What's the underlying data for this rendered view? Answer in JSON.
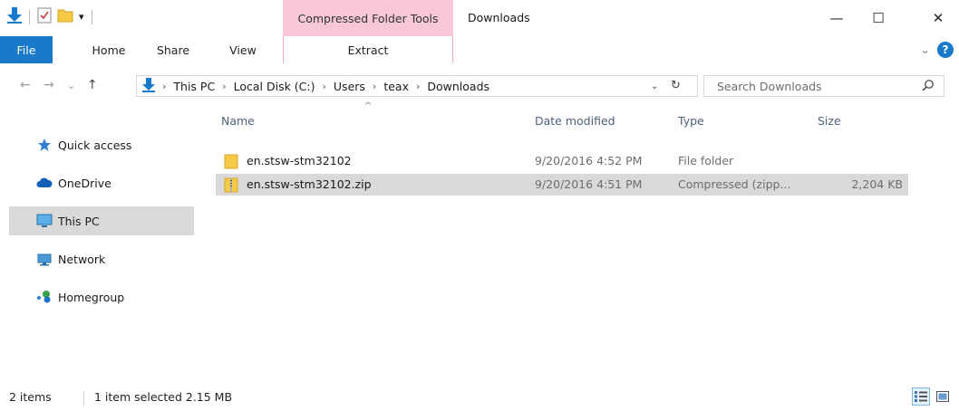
{
  "window": {
    "title": "Downloads",
    "context_tools": "Compressed Folder Tools",
    "minimize": "—",
    "maximize": "☐",
    "close": "✕"
  },
  "qat": {
    "dropdown": "▾"
  },
  "ribbon": {
    "tabs": [
      "File",
      "Home",
      "Share",
      "View",
      "Extract"
    ],
    "collapse": "⌄",
    "help": "?"
  },
  "nav": {
    "back": "←",
    "forward": "→",
    "recent": "⌄",
    "up": "↑",
    "breadcrumb": [
      "This PC",
      "Local Disk (C:)",
      "Users",
      "teax",
      "Downloads"
    ],
    "crumb_sep": "›",
    "dropdown": "⌄",
    "refresh": "↻"
  },
  "search": {
    "placeholder": "Search Downloads"
  },
  "navpane": {
    "items": [
      "Quick access",
      "OneDrive",
      "This PC",
      "Network",
      "Homegroup"
    ]
  },
  "filelist": {
    "columns": [
      "Name",
      "Date modified",
      "Type",
      "Size"
    ],
    "sort_arrow": "^",
    "rows": [
      {
        "name": "en.stsw-stm32102",
        "date": "9/20/2016 4:52 PM",
        "type": "File folder",
        "size": ""
      },
      {
        "name": "en.stsw-stm32102.zip",
        "date": "9/20/2016 4:51 PM",
        "type": "Compressed (zipp...",
        "size": "2,204 KB"
      }
    ]
  },
  "status": {
    "count": "2 items",
    "selection": "1 item selected  2.15 MB"
  },
  "colors": {
    "file_tab": "#1979ca",
    "context_tab": "#f8c6d9",
    "selection": "#d9d9d9",
    "folder": "#f7c948"
  }
}
